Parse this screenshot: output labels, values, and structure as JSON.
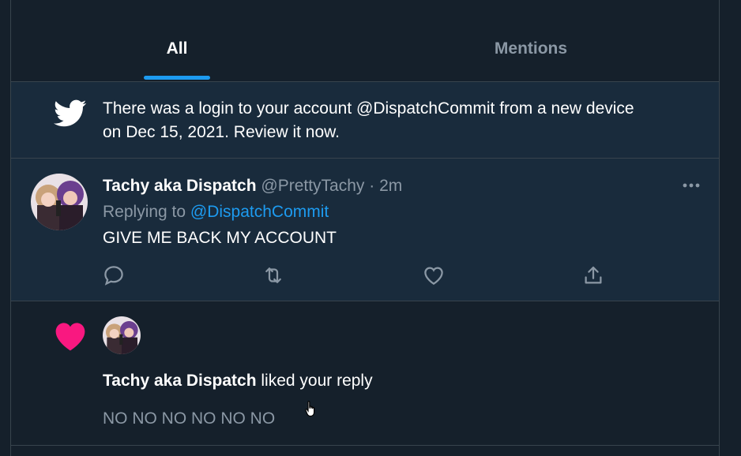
{
  "tabs": {
    "all_label": "All",
    "mentions_label": "Mentions"
  },
  "login_notice": {
    "icon": "twitter-bird-icon",
    "text_line1": "There was a login to your account @DispatchCommit from a new device",
    "text_line2": "on Dec 15, 2021. Review it now."
  },
  "tweet": {
    "display_name": "Tachy aka Dispatch",
    "handle": "@PrettyTachy",
    "separator": "·",
    "time": "2m",
    "replying_prefix": "Replying to",
    "replying_to": "@DispatchCommit",
    "body": "GIVE ME BACK MY ACCOUNT",
    "actions": [
      "reply-icon",
      "retweet-icon",
      "like-icon",
      "share-icon"
    ]
  },
  "like_notification": {
    "icon": "heart-icon",
    "user_name": "Tachy aka Dispatch",
    "action_text": "liked your reply",
    "quoted_text": "NO NO NO NO NO NO"
  },
  "colors": {
    "background": "#15202b",
    "highlight": "#192b3c",
    "accent": "#1d9bf0",
    "heart": "#f91880",
    "muted": "#8b98a5",
    "border": "#38444d"
  }
}
